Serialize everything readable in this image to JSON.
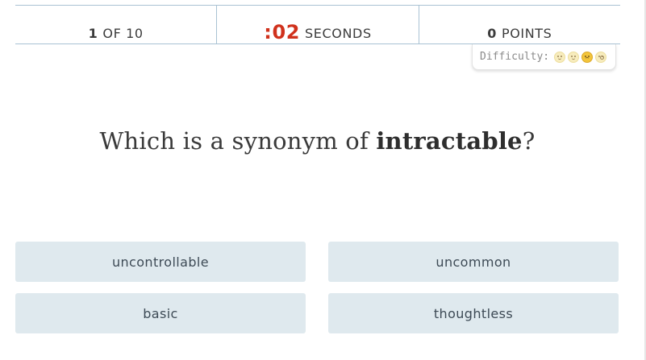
{
  "status": {
    "question_number": "1",
    "question_of": "OF 10",
    "timer_value": ":02",
    "timer_unit": "SECONDS",
    "points_value": "0",
    "points_unit": "POINTS"
  },
  "difficulty": {
    "label": "Difficulty:",
    "levels": [
      "very-easy-face-icon",
      "easy-face-icon",
      "hard-face-icon",
      "very-hard-face-icon"
    ],
    "selected_level": 3
  },
  "question": {
    "prefix": "Which is a synonym of ",
    "word": "intractable",
    "suffix": "?"
  },
  "answers": [
    {
      "label": "uncontrollable"
    },
    {
      "label": "uncommon"
    },
    {
      "label": "basic"
    },
    {
      "label": "thoughtless"
    }
  ],
  "colors": {
    "timer": "#d0311c",
    "answer_bg": "#dfe9ee",
    "divider": "#a9c2d3"
  }
}
